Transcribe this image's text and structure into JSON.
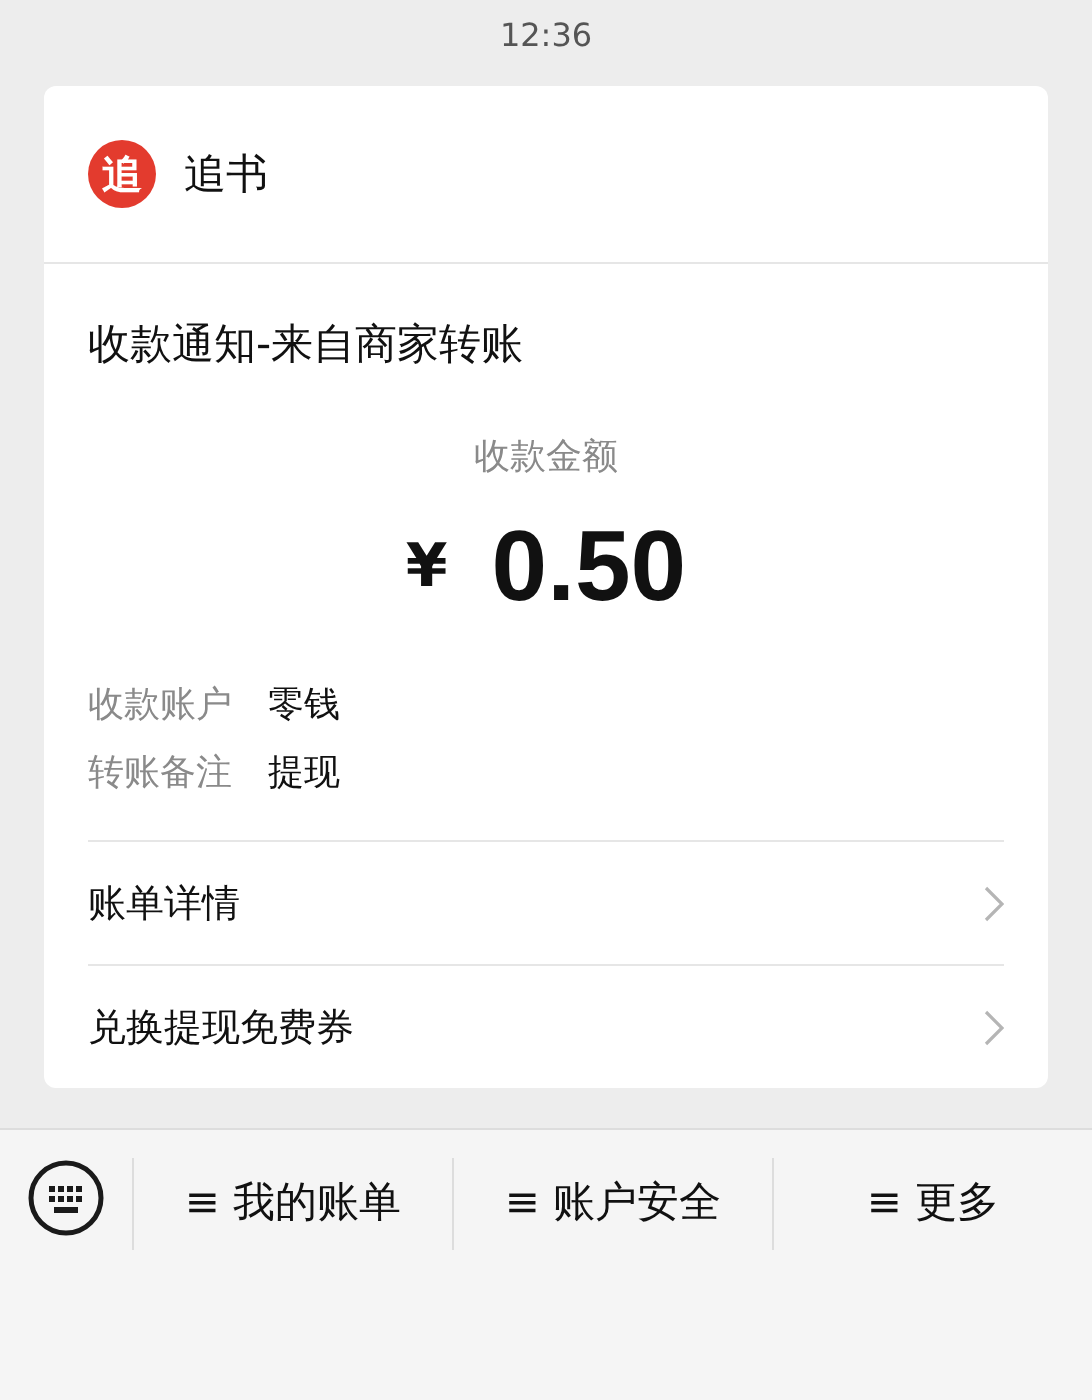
{
  "status_bar": {
    "time": "12:36"
  },
  "card": {
    "app": {
      "logo_char": "追",
      "name": "追书"
    },
    "title": "收款通知-来自商家转账",
    "amount_label": "收款金额",
    "currency": "¥",
    "amount": "0.50",
    "details": [
      {
        "label": "收款账户",
        "value": "零钱"
      },
      {
        "label": "转账备注",
        "value": "提现"
      }
    ],
    "links": [
      {
        "label": "账单详情"
      },
      {
        "label": "兑换提现免费券"
      }
    ]
  },
  "menu_bar": {
    "items": [
      {
        "label": "≡ 我的账单"
      },
      {
        "label": "≡ 账户安全"
      },
      {
        "label": "≡ 更多"
      }
    ]
  }
}
